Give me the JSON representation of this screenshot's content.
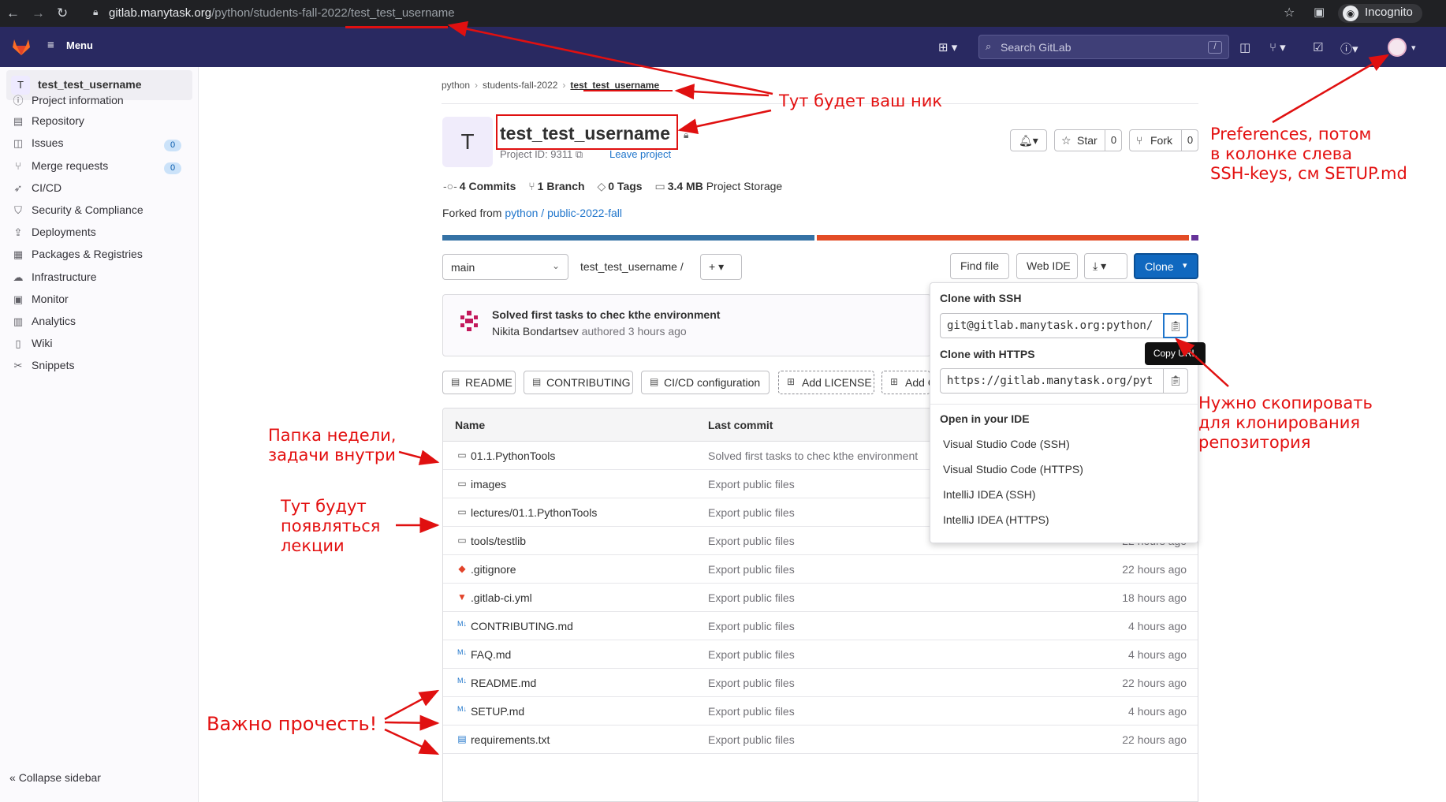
{
  "browser": {
    "url_host": "gitlab.manytask.org",
    "url_path": "/python/students-fall-2022/test_test_username",
    "incognito_label": "Incognito"
  },
  "header": {
    "menu_label": "Menu",
    "search_placeholder": "Search GitLab",
    "search_shortcut": "/"
  },
  "sidebar": {
    "project_avatar": "T",
    "project_name": "test_test_username",
    "items": [
      {
        "label": "Project information",
        "icon": "info-icon"
      },
      {
        "label": "Repository",
        "icon": "doc-icon"
      },
      {
        "label": "Issues",
        "icon": "issues-icon",
        "badge": "0"
      },
      {
        "label": "Merge requests",
        "icon": "merge-icon",
        "badge": "0"
      },
      {
        "label": "CI/CD",
        "icon": "rocket-icon"
      },
      {
        "label": "Security & Compliance",
        "icon": "shield-icon"
      },
      {
        "label": "Deployments",
        "icon": "deploy-icon"
      },
      {
        "label": "Packages & Registries",
        "icon": "package-icon"
      },
      {
        "label": "Infrastructure",
        "icon": "cloud-icon"
      },
      {
        "label": "Monitor",
        "icon": "monitor-icon"
      },
      {
        "label": "Analytics",
        "icon": "chart-icon"
      },
      {
        "label": "Wiki",
        "icon": "book-icon"
      },
      {
        "label": "Snippets",
        "icon": "scissors-icon"
      }
    ],
    "collapse_label": "Collapse sidebar"
  },
  "breadcrumb": [
    "python",
    "students-fall-2022",
    "test_test_username"
  ],
  "project": {
    "avatar": "T",
    "title": "test_test_username",
    "id_text": "Project ID: 9311",
    "leave_label": "Leave project",
    "star_label": "Star",
    "star_count": "0",
    "fork_label": "Fork",
    "fork_count": "0"
  },
  "stats": {
    "commits": "4 Commits",
    "branches": "1 Branch",
    "tags": "0 Tags",
    "storage_size": "3.4 MB",
    "storage_label": "Project Storage"
  },
  "forked": {
    "prefix": "Forked from",
    "link": "python / public-2022-fall"
  },
  "toolbar": {
    "branch": "main",
    "path": "test_test_username",
    "path_sep": "/",
    "find_file": "Find file",
    "web_ide": "Web IDE",
    "clone": "Clone"
  },
  "commit": {
    "title": "Solved first tasks to chec kthe environment",
    "author": "Nikita Bondartsev",
    "time": "authored 3 hours ago"
  },
  "tabs": [
    "README",
    "CONTRIBUTING",
    "CI/CD configuration",
    "Add LICENSE",
    "Add C"
  ],
  "table": {
    "col_name": "Name",
    "col_commit": "Last commit",
    "rows": [
      {
        "name": "01.1.PythonTools",
        "commit": "Solved first tasks to chec kthe environment",
        "time": "",
        "icon": "folder-icon"
      },
      {
        "name": "images",
        "commit": "Export public files",
        "time": "",
        "icon": "folder-icon"
      },
      {
        "name": "lectures/01.1.PythonTools",
        "commit": "Export public files",
        "time": "",
        "icon": "folder-icon"
      },
      {
        "name": "tools/testlib",
        "commit": "Export public files",
        "time": "22 hours ago",
        "icon": "folder-icon"
      },
      {
        "name": ".gitignore",
        "commit": "Export public files",
        "time": "22 hours ago",
        "icon": "git-icon"
      },
      {
        "name": ".gitlab-ci.yml",
        "commit": "Export public files",
        "time": "18 hours ago",
        "icon": "gitlab-icon"
      },
      {
        "name": "CONTRIBUTING.md",
        "commit": "Export public files",
        "time": "4 hours ago",
        "icon": "markdown-icon"
      },
      {
        "name": "FAQ.md",
        "commit": "Export public files",
        "time": "4 hours ago",
        "icon": "markdown-icon"
      },
      {
        "name": "README.md",
        "commit": "Export public files",
        "time": "22 hours ago",
        "icon": "markdown-icon"
      },
      {
        "name": "SETUP.md",
        "commit": "Export public files",
        "time": "4 hours ago",
        "icon": "markdown-icon"
      },
      {
        "name": "requirements.txt",
        "commit": "Export public files",
        "time": "22 hours ago",
        "icon": "text-file-icon"
      }
    ]
  },
  "clone_dropdown": {
    "ssh_title": "Clone with SSH",
    "ssh_url": "git@gitlab.manytask.org:python/",
    "https_title": "Clone with HTTPS",
    "https_url": "https://gitlab.manytask.org/pyt",
    "copy_tooltip": "Copy URL",
    "ide_title": "Open in your IDE",
    "ide_items": [
      "Visual Studio Code (SSH)",
      "Visual Studio Code (HTTPS)",
      "IntelliJ IDEA (SSH)",
      "IntelliJ IDEA (HTTPS)"
    ]
  },
  "annotations": {
    "nick": "Тут будет ваш ник",
    "preferences": "Preferences, потом\nв колонке слева\nSSH-keys, см SETUP.md",
    "week_folder": "Папка недели,\nзадачи внутри",
    "lectures": "Тут будут\nпоявляться\nлекции",
    "copy_clone": "Нужно скопировать\nдля клонирования\nрепозитория",
    "read": "Важно прочесть!"
  },
  "colors": {
    "header": "#292961",
    "accent": "#1068bf",
    "annotation": "#e31010",
    "lang_bar": [
      "#3572a5",
      "#e34c26",
      "#663399"
    ]
  }
}
